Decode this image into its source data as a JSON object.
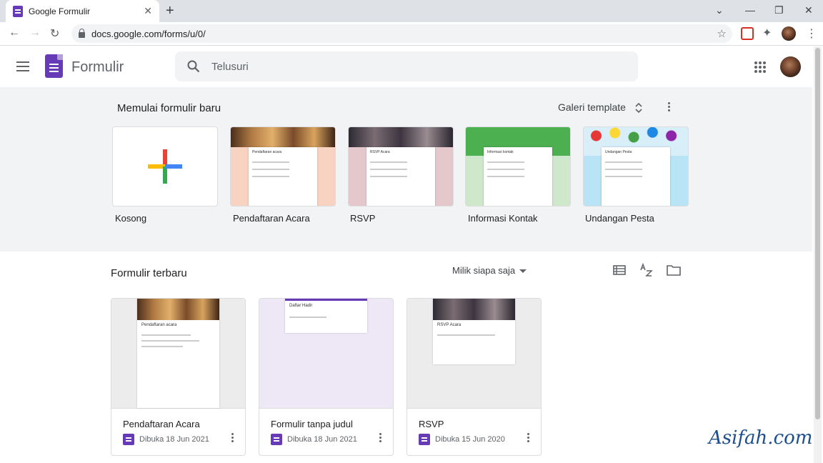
{
  "browser": {
    "tab_title": "Google Formulir",
    "tab_close": "✕",
    "new_tab": "+",
    "url": "docs.google.com/forms/u/0/"
  },
  "app": {
    "title": "Formulir",
    "search_placeholder": "Telusuri"
  },
  "templates": {
    "heading": "Memulai formulir baru",
    "gallery_label": "Galeri template",
    "items": [
      {
        "label": "Kosong",
        "form_title": ""
      },
      {
        "label": "Pendaftaran Acara",
        "form_title": "Pendaftaran acara"
      },
      {
        "label": "RSVP",
        "form_title": "RSVP Acara"
      },
      {
        "label": "Informasi Kontak",
        "form_title": "Informasi kontak"
      },
      {
        "label": "Undangan Pesta",
        "form_title": "Undangan Pesta"
      }
    ]
  },
  "recent": {
    "heading": "Formulir terbaru",
    "owner_filter": "Milik siapa saja",
    "forms": [
      {
        "name": "Pendaftaran Acara",
        "opened": "Dibuka 18 Jun 2021",
        "thumb_title": "Pendaftaran acara"
      },
      {
        "name": "Formulir tanpa judul",
        "opened": "Dibuka 18 Jun 2021",
        "thumb_title": "Daftar Hadir"
      },
      {
        "name": "RSVP",
        "opened": "Dibuka 15 Jun 2020",
        "thumb_title": "RSVP Acara"
      }
    ]
  },
  "watermark": "Asifah.com",
  "colors": {
    "forms_purple": "#673ab7",
    "section_gray": "#f1f3f4",
    "google_blue": "#4285f4",
    "google_red": "#ea4335",
    "google_yellow": "#fbbc04",
    "google_green": "#34a853"
  }
}
